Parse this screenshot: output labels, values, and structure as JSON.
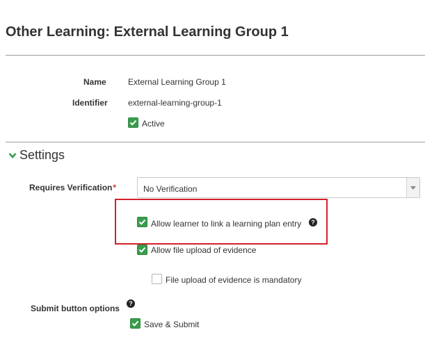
{
  "page": {
    "title": "Other Learning: External Learning Group 1"
  },
  "details": {
    "name_label": "Name",
    "name_value": "External Learning Group 1",
    "identifier_label": "Identifier",
    "identifier_value": "external-learning-group-1",
    "active_label": "Active",
    "active_checked": true
  },
  "settings": {
    "section_title": "Settings",
    "expanded": true,
    "requires_verification_label": "Requires Verification",
    "required_marker": "*",
    "requires_verification_value": "No Verification",
    "allow_link_label": "Allow learner to link a learning plan entry",
    "allow_link_checked": true,
    "allow_upload_label": "Allow file upload of evidence",
    "allow_upload_checked": true,
    "upload_mandatory_label": "File upload of evidence is mandatory",
    "upload_mandatory_checked": false,
    "submit_options_label": "Submit button options",
    "save_submit_label": "Save & Submit",
    "save_submit_checked": true,
    "help_glyph": "?"
  },
  "colors": {
    "checkbox_green": "#3a9c4d",
    "highlight_red": "#d3202a",
    "chevron_green": "#3a9c4d"
  }
}
